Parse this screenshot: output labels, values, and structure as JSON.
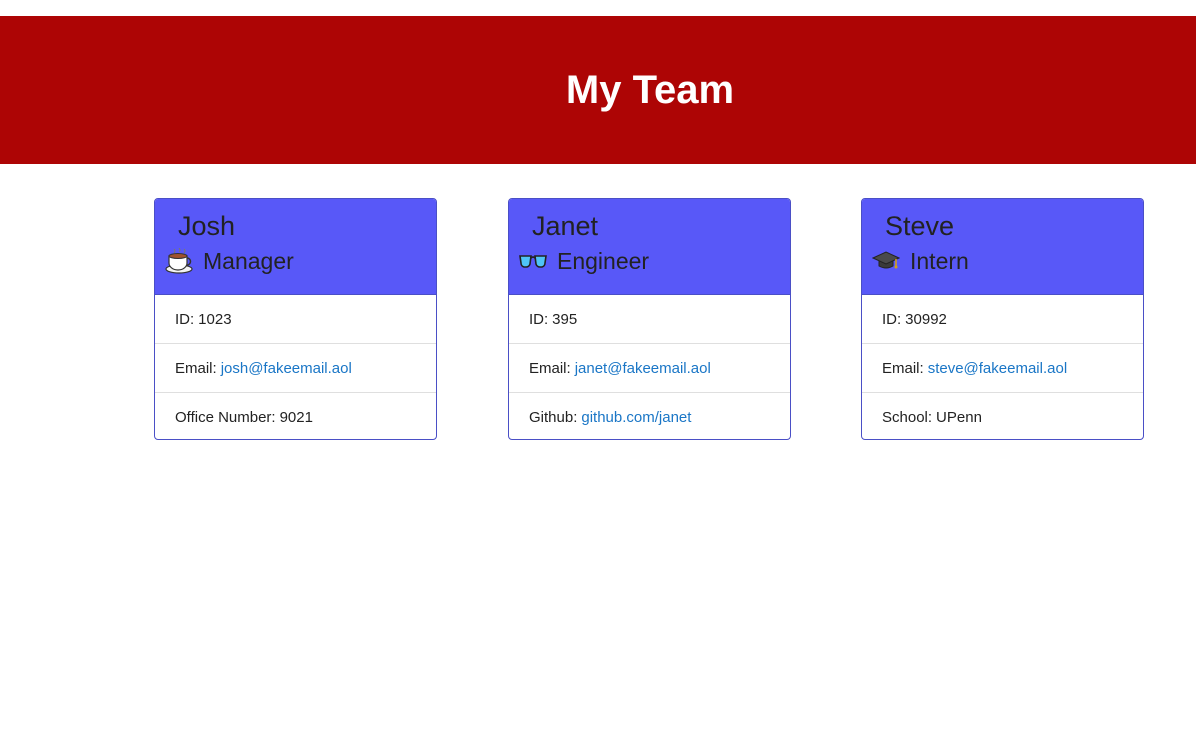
{
  "header": {
    "title": "My Team",
    "bg_color": "#ad0505"
  },
  "accent": {
    "card_header": "#5858f8",
    "link": "#1a76c6"
  },
  "cards": [
    {
      "name": "Josh",
      "role": "Manager",
      "role_icon": "coffee-icon",
      "id_label": "ID:",
      "id": "1023",
      "email_label": "Email:",
      "email": "josh@fakeemail.aol",
      "extra_label": "Office Number:",
      "extra": "9021"
    },
    {
      "name": "Janet",
      "role": "Engineer",
      "role_icon": "glasses-icon",
      "id_label": "ID:",
      "id": "395",
      "email_label": "Email:",
      "email": "janet@fakeemail.aol",
      "extra_label": "Github:",
      "extra": "github.com/janet"
    },
    {
      "name": "Steve",
      "role": "Intern",
      "role_icon": "graduation-cap-icon",
      "id_label": "ID:",
      "id": "30992",
      "email_label": "Email:",
      "email": "steve@fakeemail.aol",
      "extra_label": "School:",
      "extra": "UPenn"
    }
  ]
}
